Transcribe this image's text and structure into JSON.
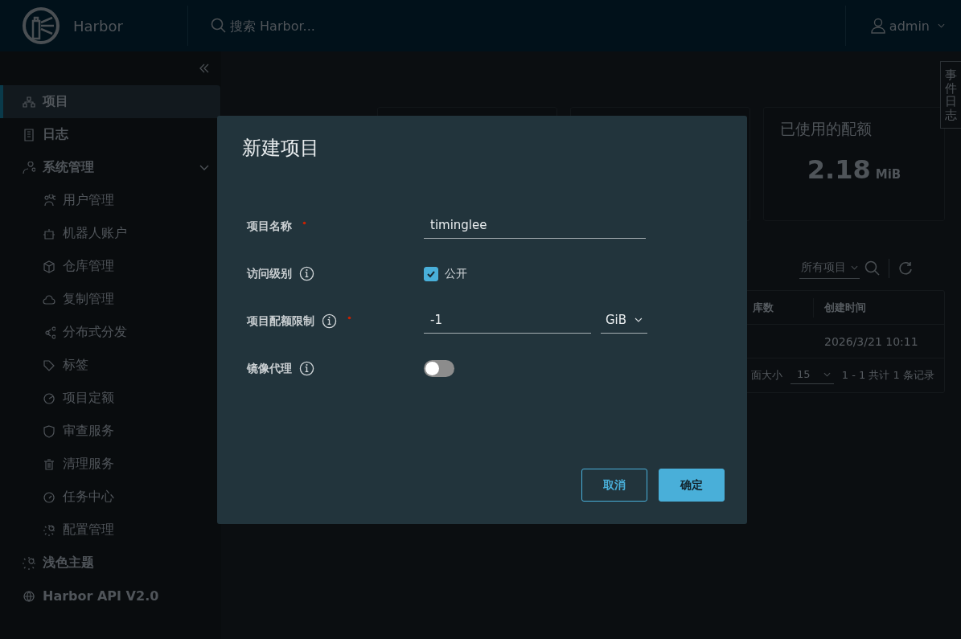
{
  "header": {
    "brand": "Harbor",
    "search": {
      "placeholder": "搜索 Harbor..."
    },
    "user": "admin"
  },
  "sidebar": {
    "items": [
      {
        "label": "项目",
        "selected": true
      },
      {
        "label": "日志",
        "selected": false
      },
      {
        "label": "系统管理",
        "selected": false,
        "expanded": true,
        "children": [
          {
            "label": "用户管理",
            "selected": false
          },
          {
            "label": "机器人账户",
            "selected": false
          },
          {
            "label": "仓库管理",
            "selected": false
          },
          {
            "label": "复制管理",
            "selected": false
          },
          {
            "label": "分布式分发",
            "selected": false
          },
          {
            "label": "标签",
            "selected": false
          },
          {
            "label": "项目定额",
            "selected": false
          },
          {
            "label": "审查服务",
            "selected": false
          },
          {
            "label": "清理服务",
            "selected": false
          },
          {
            "label": "任务中心",
            "selected": false
          },
          {
            "label": "配置管理",
            "selected": false
          }
        ]
      }
    ],
    "footer_items": [
      {
        "label": "浅色主题"
      },
      {
        "label": "Harbor API V2.0"
      }
    ]
  },
  "page": {
    "quota_card": {
      "title": "已使用的配额",
      "value": "2.18",
      "unit": "MiB"
    },
    "filter": "所有项目",
    "table": {
      "columns": [
        "库数",
        "创建时间"
      ],
      "rows": [
        {
          "created": "2026/3/21 10:11"
        }
      ],
      "page_size_label": "面大小",
      "page_size": "15",
      "summary": "1 - 1 共计 1 条记录"
    }
  },
  "event_tab": "事件日志",
  "dialog": {
    "title": "新建项目",
    "fields": [
      {
        "kind": "text",
        "label": "项目名称",
        "required": true,
        "info": false,
        "value": "timinglee"
      },
      {
        "kind": "checkbox",
        "label": "访问级别",
        "required": false,
        "info": true,
        "checked": true,
        "option": "公开"
      },
      {
        "kind": "quota",
        "label": "项目配额限制",
        "required": true,
        "info": true,
        "value": "-1",
        "unit": "GiB"
      },
      {
        "kind": "toggle",
        "label": "镜像代理",
        "required": false,
        "info": true,
        "on": false
      }
    ],
    "buttons": [
      {
        "label": "取消",
        "primary": false
      },
      {
        "label": "确定",
        "primary": true
      }
    ]
  }
}
